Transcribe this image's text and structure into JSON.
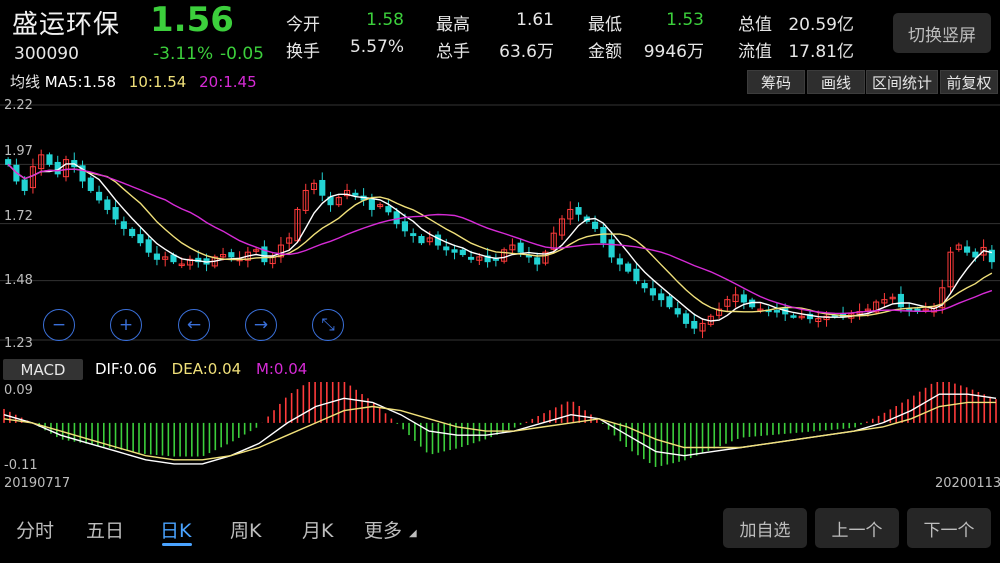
{
  "header": {
    "stock_name": "盛运环保",
    "price": "1.56",
    "code": "300090",
    "change_pct": "-3.11%",
    "change": "-0.05"
  },
  "quote": {
    "open_label": "今开",
    "open": "1.58",
    "high_label": "最高",
    "high": "1.61",
    "low_label": "最低",
    "low": "1.53",
    "mcap_label": "总值",
    "mcap": "20.59亿",
    "turnover_label": "换手",
    "turnover": "5.57%",
    "volume_label": "总手",
    "volume": "63.6万",
    "amount_label": "金额",
    "amount": "9946万",
    "float_label": "流值",
    "float": "17.81亿"
  },
  "switch_button": "切换竖屏",
  "ma_line": {
    "label": "均线",
    "ma5": "MA5:1.58",
    "ma10": "10:1.54",
    "ma20": "20:1.45"
  },
  "toolbar": {
    "chips": "筹码",
    "draw": "画线",
    "interval": "区间统计",
    "adjust": "前复权"
  },
  "price_axis": [
    "2.22",
    "1.97",
    "1.72",
    "1.48",
    "1.23"
  ],
  "macd": {
    "button": "MACD",
    "dif": "DIF:0.06",
    "dea": "DEA:0.04",
    "m": "M:0.04",
    "axis_top": "0.09",
    "axis_bottom": "-0.11"
  },
  "dates": {
    "start": "20190717",
    "end": "20200113"
  },
  "nav": {
    "items": [
      "分时",
      "五日",
      "日K",
      "周K",
      "月K",
      "更多"
    ]
  },
  "actions": {
    "add_watch": "加自选",
    "prev": "上一个",
    "next": "下一个"
  },
  "colors": {
    "up": "#ff3b3b",
    "down": "#3ccf3c",
    "flat_candle": "#23d3d3",
    "ma5": "#ffffff",
    "ma10": "#f0e07a",
    "ma20": "#d62bd6"
  },
  "chart_data": {
    "type": "candlestick",
    "ylim": [
      1.23,
      2.22
    ],
    "x_start": "20190717",
    "x_end": "20200113",
    "ma": {
      "ma5": 1.58,
      "ma10": 1.54,
      "ma20": 1.45
    },
    "close": [
      1.97,
      1.9,
      1.86,
      1.96,
      2.01,
      1.97,
      1.93,
      1.99,
      1.96,
      1.9,
      1.86,
      1.82,
      1.78,
      1.74,
      1.7,
      1.67,
      1.64,
      1.6,
      1.57,
      1.58,
      1.56,
      1.55,
      1.57,
      1.56,
      1.55,
      1.58,
      1.59,
      1.58,
      1.57,
      1.6,
      1.61,
      1.56,
      1.58,
      1.63,
      1.66,
      1.78,
      1.86,
      1.89,
      1.84,
      1.8,
      1.83,
      1.86,
      1.84,
      1.82,
      1.78,
      1.8,
      1.77,
      1.72,
      1.69,
      1.67,
      1.64,
      1.66,
      1.63,
      1.61,
      1.6,
      1.59,
      1.57,
      1.58,
      1.56,
      1.57,
      1.61,
      1.63,
      1.6,
      1.58,
      1.55,
      1.6,
      1.68,
      1.74,
      1.78,
      1.76,
      1.73,
      1.7,
      1.64,
      1.58,
      1.55,
      1.52,
      1.48,
      1.45,
      1.42,
      1.4,
      1.37,
      1.34,
      1.3,
      1.28,
      1.3,
      1.33,
      1.36,
      1.4,
      1.42,
      1.39,
      1.37,
      1.36,
      1.35,
      1.35,
      1.34,
      1.33,
      1.33,
      1.32,
      1.32,
      1.33,
      1.33,
      1.33,
      1.34,
      1.35,
      1.36,
      1.39,
      1.4,
      1.41,
      1.37,
      1.36,
      1.35,
      1.36,
      1.37,
      1.45,
      1.6,
      1.63,
      1.6,
      1.58,
      1.62,
      1.56
    ],
    "macd_dif": [
      0.02,
      0.0,
      -0.03,
      -0.05,
      -0.07,
      -0.09,
      -0.1,
      -0.1,
      -0.08,
      -0.05,
      0.0,
      0.04,
      0.06,
      0.05,
      0.02,
      -0.02,
      -0.03,
      -0.03,
      -0.02,
      0.0,
      0.02,
      0.01,
      -0.03,
      -0.07,
      -0.08,
      -0.07,
      -0.06,
      -0.05,
      -0.04,
      -0.03,
      -0.02,
      0.0,
      0.03,
      0.07,
      0.07,
      0.06
    ],
    "macd_dea": [
      0.01,
      0.0,
      -0.02,
      -0.04,
      -0.06,
      -0.08,
      -0.09,
      -0.09,
      -0.08,
      -0.06,
      -0.03,
      0.0,
      0.03,
      0.04,
      0.03,
      0.01,
      -0.01,
      -0.02,
      -0.02,
      -0.01,
      0.0,
      0.01,
      -0.01,
      -0.04,
      -0.06,
      -0.06,
      -0.06,
      -0.05,
      -0.04,
      -0.03,
      -0.02,
      -0.01,
      0.01,
      0.04,
      0.05,
      0.05
    ]
  }
}
